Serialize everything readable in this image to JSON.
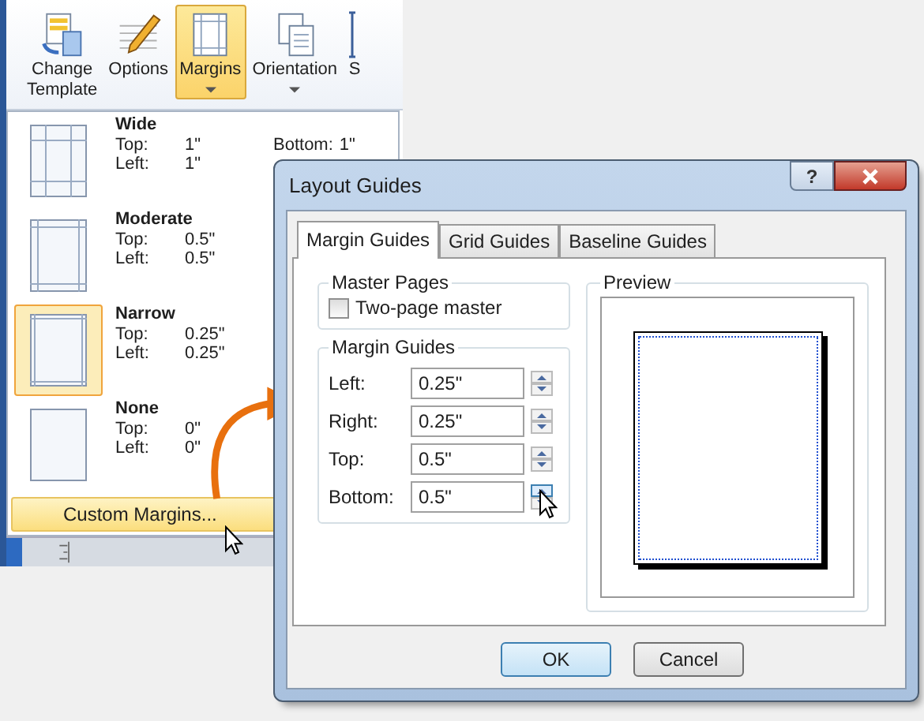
{
  "ribbon": {
    "buttons": [
      {
        "label": "Change\nTemplate",
        "kind": "template",
        "selected": false,
        "dropdown": false
      },
      {
        "label": "Options",
        "kind": "options",
        "selected": false,
        "dropdown": false
      },
      {
        "label": "Margins",
        "kind": "margins",
        "selected": true,
        "dropdown": true
      },
      {
        "label": "Orientation",
        "kind": "orientation",
        "selected": false,
        "dropdown": true
      },
      {
        "label": "S",
        "kind": "size",
        "selected": false,
        "dropdown": false
      }
    ]
  },
  "margin_menu": {
    "items": [
      {
        "name": "Wide",
        "selected": false,
        "fields": [
          {
            "label": "Top:",
            "value": "1\""
          },
          {
            "label": "Left:",
            "value": "1\""
          },
          {
            "label": "Bottom:",
            "value": "1\""
          }
        ]
      },
      {
        "name": "Moderate",
        "selected": false,
        "fields": [
          {
            "label": "Top:",
            "value": "0.5\""
          },
          {
            "label": "Left:",
            "value": "0.5\""
          }
        ]
      },
      {
        "name": "Narrow",
        "selected": true,
        "fields": [
          {
            "label": "Top:",
            "value": "0.25\""
          },
          {
            "label": "Left:",
            "value": "0.25\""
          }
        ]
      },
      {
        "name": "None",
        "selected": false,
        "fields": [
          {
            "label": "Top:",
            "value": "0\""
          },
          {
            "label": "Left:",
            "value": "0\""
          }
        ]
      }
    ],
    "custom": "Custom Margins..."
  },
  "dialog": {
    "title": "Layout Guides",
    "help": "?",
    "tabs": [
      {
        "label": "Margin Guides",
        "selected": true
      },
      {
        "label": "Grid Guides",
        "selected": false
      },
      {
        "label": "Baseline Guides",
        "selected": false
      }
    ],
    "master_pages": {
      "title": "Master Pages",
      "checkbox": {
        "label": "Two-page master",
        "checked": false
      }
    },
    "margin_guides": {
      "title": "Margin Guides",
      "fields": [
        {
          "label": "Left:",
          "value": "0.25\""
        },
        {
          "label": "Right:",
          "value": "0.25\""
        },
        {
          "label": "Top:",
          "value": "0.5\""
        },
        {
          "label": "Bottom:",
          "value": "0.5\""
        }
      ]
    },
    "preview": {
      "title": "Preview"
    },
    "buttons": [
      {
        "label": "OK",
        "default": true
      },
      {
        "label": "Cancel",
        "default": false
      }
    ]
  }
}
